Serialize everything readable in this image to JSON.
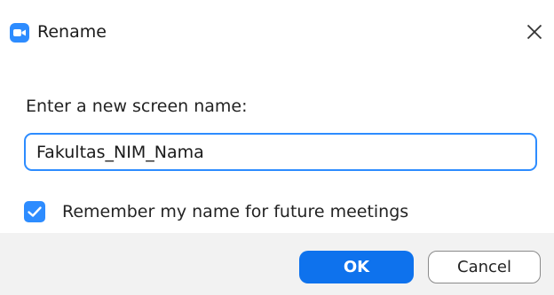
{
  "window": {
    "title": "Rename",
    "app_icon": "zoom-camera-icon",
    "close_icon": "close-icon"
  },
  "form": {
    "prompt": "Enter a new screen name:",
    "name_value": "Fakultas_NIM_Nama",
    "remember_checked": true,
    "remember_label": "Remember my name for future meetings"
  },
  "footer": {
    "ok_label": "OK",
    "cancel_label": "Cancel"
  },
  "colors": {
    "accent": "#2d8cff",
    "primary_button": "#0e72ed",
    "footer_bg": "#f2f2f2"
  }
}
